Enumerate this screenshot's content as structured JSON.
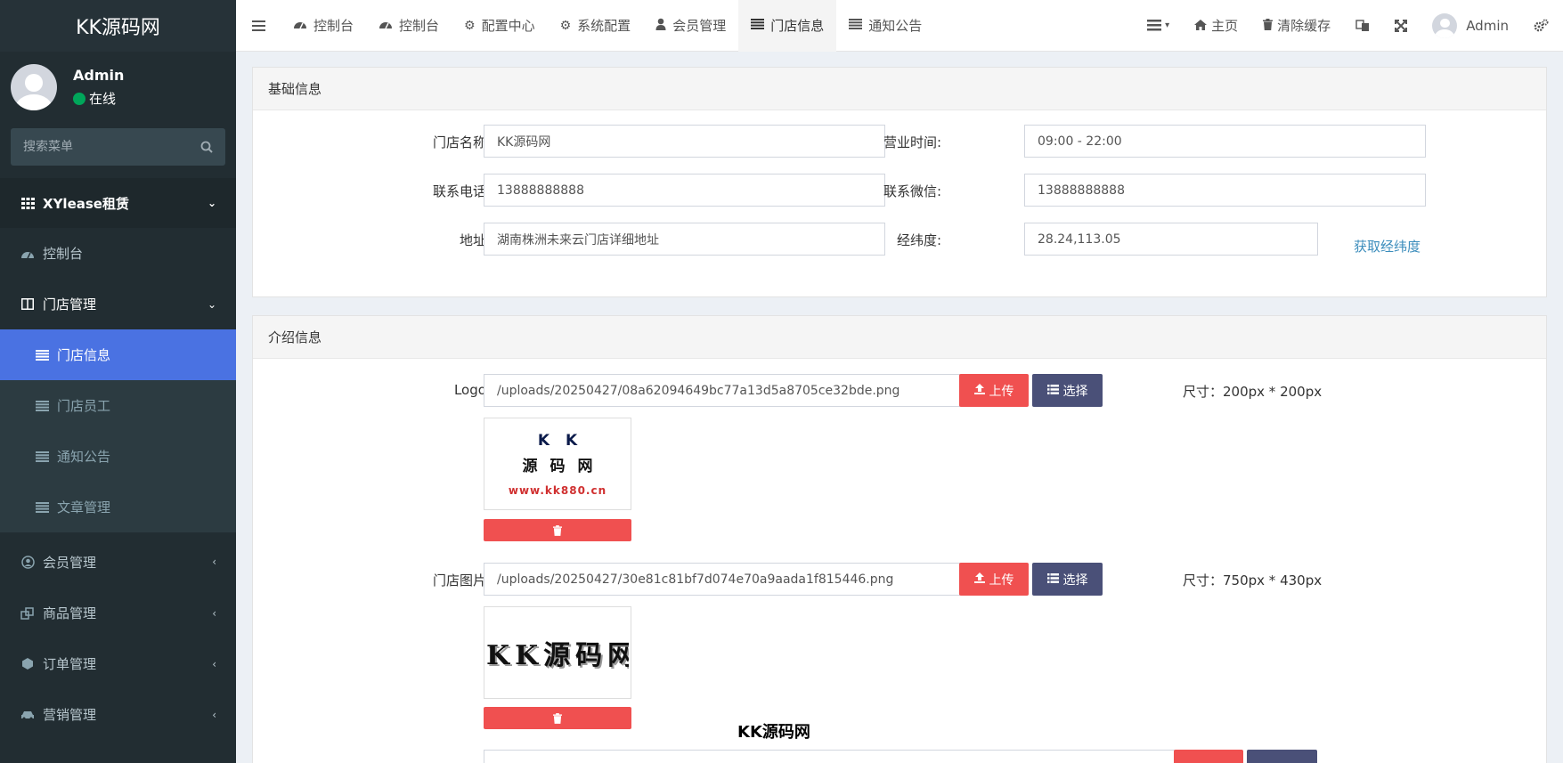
{
  "brand": "KK源码网",
  "user": {
    "name": "Admin",
    "status": "在线"
  },
  "search": {
    "placeholder": "搜索菜单"
  },
  "menu": {
    "section": "XYlease租赁",
    "dashboard": "控制台",
    "store_group": "门店管理",
    "store_sub": [
      "门店信息",
      "门店员工",
      "通知公告",
      "文章管理"
    ],
    "members": "会员管理",
    "goods": "商品管理",
    "orders": "订单管理",
    "marketing": "营销管理"
  },
  "tabs": [
    "控制台",
    "控制台",
    "配置中心",
    "系统配置",
    "会员管理",
    "门店信息",
    "通知公告"
  ],
  "topright": {
    "home": "主页",
    "clear_cache": "清除缓存",
    "admin": "Admin"
  },
  "basic": {
    "title": "基础信息",
    "store_name_label": "门店名称:",
    "store_name": "KK源码网",
    "hours_label": "营业时间:",
    "hours": "09:00 - 22:00",
    "phone_label": "联系电话:",
    "phone": "13888888888",
    "wechat_label": "联系微信:",
    "wechat": "13888888888",
    "address_label": "地址:",
    "address": "湖南株洲未来云门店详细地址",
    "coords_label": "经纬度:",
    "coords": "28.24,113.05",
    "get_coords": "获取经纬度"
  },
  "intro": {
    "title": "介绍信息",
    "logo_label": "Logo:",
    "logo_path": "/uploads/20250427/08a62094649bc77a13d5a8705ce32bde.png",
    "logo_size": "尺寸：200px * 200px",
    "store_img_label": "门店图片:",
    "store_img_path": "/uploads/20250427/30e81c81bf7d074e70a9aada1f815446.png",
    "store_img_size": "尺寸：750px * 430px",
    "upload": "上传",
    "select": "选择",
    "logo_text_1": "KK",
    "logo_text_2": "源码网",
    "logo_text_3": "www.kk880.cn",
    "store_img_text": "KK源码网"
  },
  "watermark": "KK源码网"
}
